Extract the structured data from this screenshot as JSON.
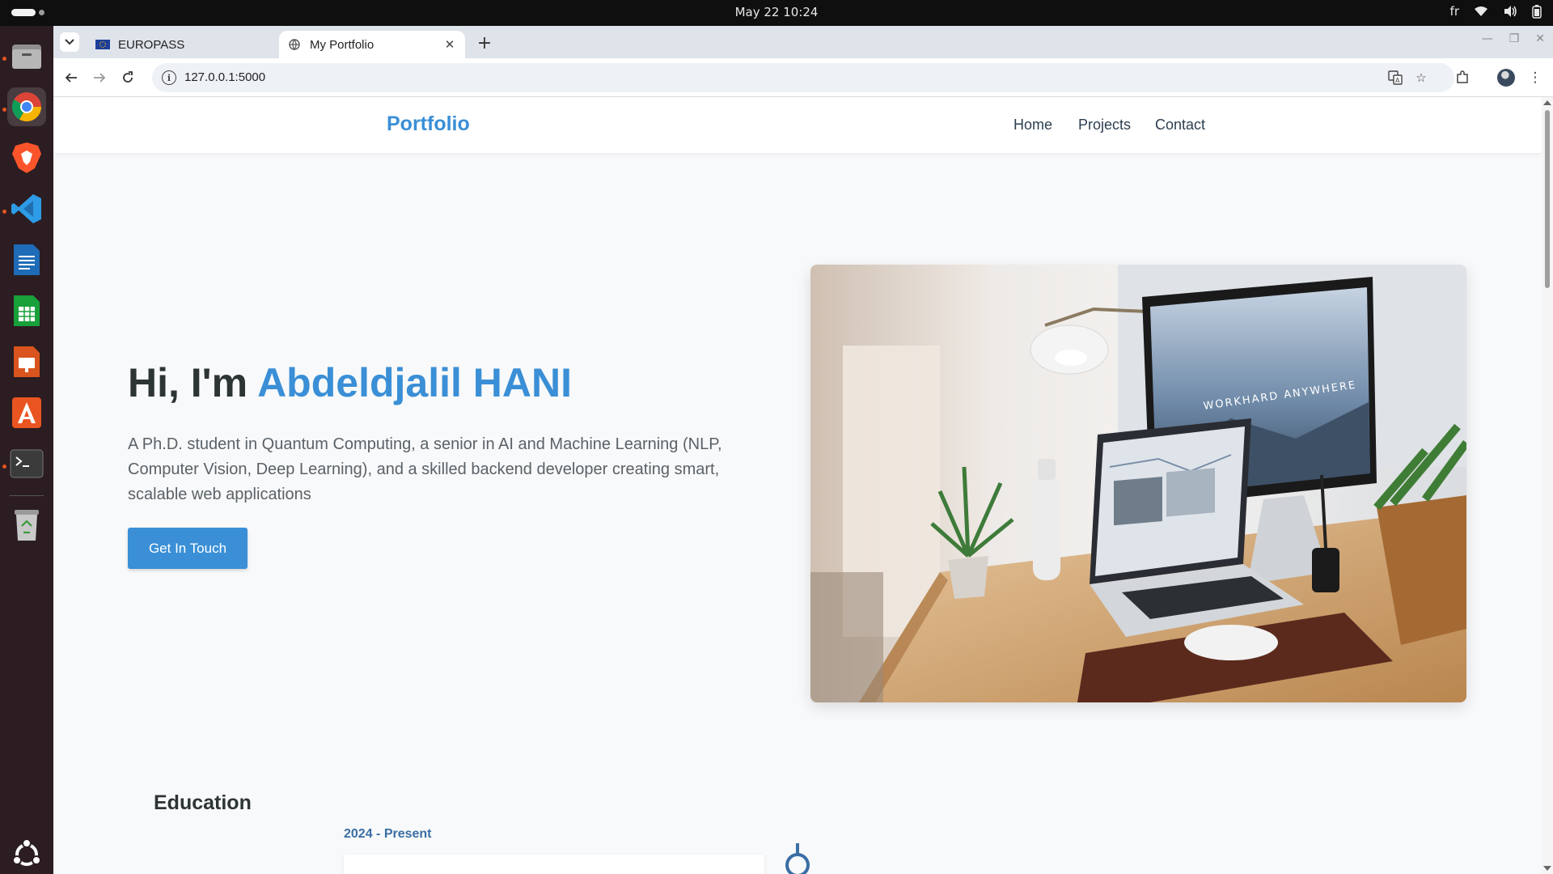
{
  "system": {
    "clock": "May 22  10:24",
    "keyboard_layout": "fr"
  },
  "dock": {
    "items": [
      "files",
      "chrome",
      "brave",
      "vscode",
      "writer",
      "calc",
      "impress",
      "app-center",
      "terminal",
      "trash",
      "show-apps"
    ]
  },
  "browser": {
    "tabs": [
      {
        "title": "EUROPASS",
        "active": false
      },
      {
        "title": "My Portfolio",
        "active": true
      }
    ],
    "url": "127.0.0.1:5000"
  },
  "site": {
    "brand": "Portfolio",
    "nav": [
      "Home",
      "Projects",
      "Contact"
    ],
    "hero": {
      "greeting": "Hi, I'm ",
      "name": "Abdeldjalil HANI",
      "description": "A Ph.D. student in Quantum Computing, a senior in AI and Machine Learning (NLP, Computer Vision, Deep Learning), and a skilled backend developer creating smart, scalable web applications",
      "cta": "Get In Touch",
      "image_text": "WORKHARD ANYWHERE"
    },
    "education": {
      "title": "Education",
      "entries": [
        {
          "date": "2024 - Present"
        }
      ]
    }
  },
  "colors": {
    "accent": "#3a8fd6",
    "timeline": "#3a6ea5",
    "dock_bg": "#2b1d21"
  }
}
